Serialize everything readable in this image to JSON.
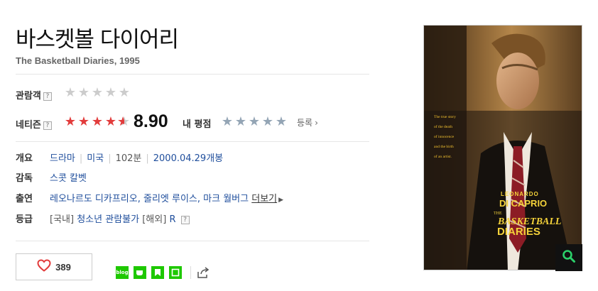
{
  "movie": {
    "title": "바스켓볼 다이어리",
    "subtitle": "The Basketball Diaries, 1995"
  },
  "ratings": {
    "audience_label": "관람객",
    "audience_help": "?",
    "audience_stars": 0,
    "netizen_label": "네티즌",
    "netizen_help": "?",
    "netizen_stars_fraction": 0.89,
    "netizen_score": "8.90",
    "my_rating_label": "내 평점",
    "my_rating_stars": 0,
    "register_label": "등록",
    "register_arrow": "›"
  },
  "info": {
    "genre_label": "개요",
    "genre": "드라마",
    "country": "미국",
    "runtime": "102분",
    "release": "2000.04.29개봉",
    "director_label": "감독",
    "director": "스콧 칼벳",
    "cast_label": "출연",
    "cast": "레오나르도 디카프리오, 줄리엣 루이스, 마크 월버그",
    "cast_more": "더보기",
    "cast_more_arrow": "▶",
    "grade_label": "등급",
    "grade_domestic_tag": "[국내]",
    "grade_domestic": "청소년 관람불가",
    "grade_overseas_tag": "[해외]",
    "grade_overseas": "R",
    "grade_help": "?"
  },
  "actions": {
    "like_count": "389",
    "share_icons": [
      "blog-share-icon",
      "cafe-share-icon",
      "bookmark-share-icon",
      "memo-share-icon",
      "external-share-icon"
    ]
  },
  "poster": {
    "tagline": [
      "The true story",
      "of the death",
      "of innocence",
      "and the birth",
      "of an artist."
    ],
    "actor_first": "LEONARDO",
    "actor_last": "DI CAPRIO",
    "film_small": "THE",
    "film_line1": "BASKETBALL",
    "film_line2": "DIARIES"
  },
  "colors": {
    "star_red": "#e23c3c",
    "star_blue": "#94a5b5",
    "star_empty": "#cccccc",
    "link_blue": "#1f4e9c",
    "share_green": "#1ec800"
  }
}
